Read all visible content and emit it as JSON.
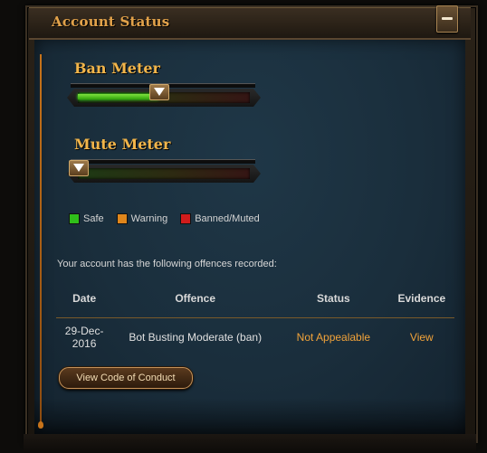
{
  "panel": {
    "title": "Account Status"
  },
  "ban_meter": {
    "title": "Ban Meter",
    "level": 0.47
  },
  "mute_meter": {
    "title": "Mute Meter",
    "level": 0.0
  },
  "legend": [
    {
      "label": "Safe",
      "color": "#2fbf1a"
    },
    {
      "label": "Warning",
      "color": "#e0861b"
    },
    {
      "label": "Banned/Muted",
      "color": "#d11c1c"
    }
  ],
  "offences": {
    "intro": "Your account has the following offences recorded:",
    "headers": [
      "Date",
      "Offence",
      "Status",
      "Evidence"
    ],
    "rows": [
      {
        "date": "29-Dec-2016",
        "offence": "Bot Busting Moderate (ban)",
        "status": "Not Appealable",
        "evidence": "View"
      }
    ]
  },
  "conduct_button": "View Code of Conduct",
  "colors": {
    "accent": "#f2a33a",
    "title": "#e2a24a"
  }
}
